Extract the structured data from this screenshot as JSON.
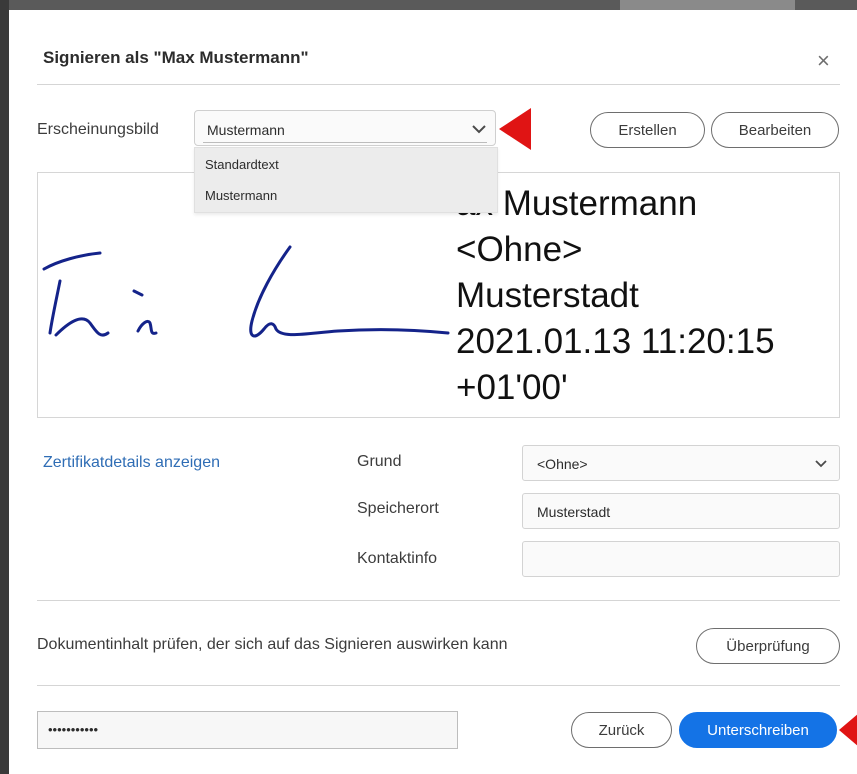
{
  "dialog": {
    "title": "Signieren als \"Max Mustermann\"",
    "close_symbol": "×"
  },
  "appearance": {
    "label": "Erscheinungsbild",
    "selected": "Mustermann",
    "options": [
      "Standardtext",
      "Mustermann"
    ],
    "create_label": "Erstellen",
    "edit_label": "Bearbeiten"
  },
  "preview": {
    "lines": [
      "Max Mustermann",
      "<Ohne>",
      "Musterstadt",
      "2021.01.13 11:20:15",
      "+01'00'"
    ],
    "line0_visible": "ax Mustermann"
  },
  "details": {
    "link_label": "Zertifikatdetails anzeigen",
    "reason_label": "Grund",
    "reason_value": "<Ohne>",
    "location_label": "Speicherort",
    "location_value": "Musterstadt",
    "contact_label": "Kontaktinfo",
    "contact_value": ""
  },
  "review": {
    "text": "Dokumentinhalt prüfen, der sich auf das Signieren auswirken kann",
    "button_label": "Überprüfung"
  },
  "footer": {
    "password_value": "•••••••••••",
    "back_label": "Zurück",
    "sign_label": "Unterschreiben"
  },
  "colors": {
    "primary": "#1473e6",
    "link": "#2f6db5",
    "annotation_arrow": "#e01414",
    "signature_ink": "#14238a"
  }
}
